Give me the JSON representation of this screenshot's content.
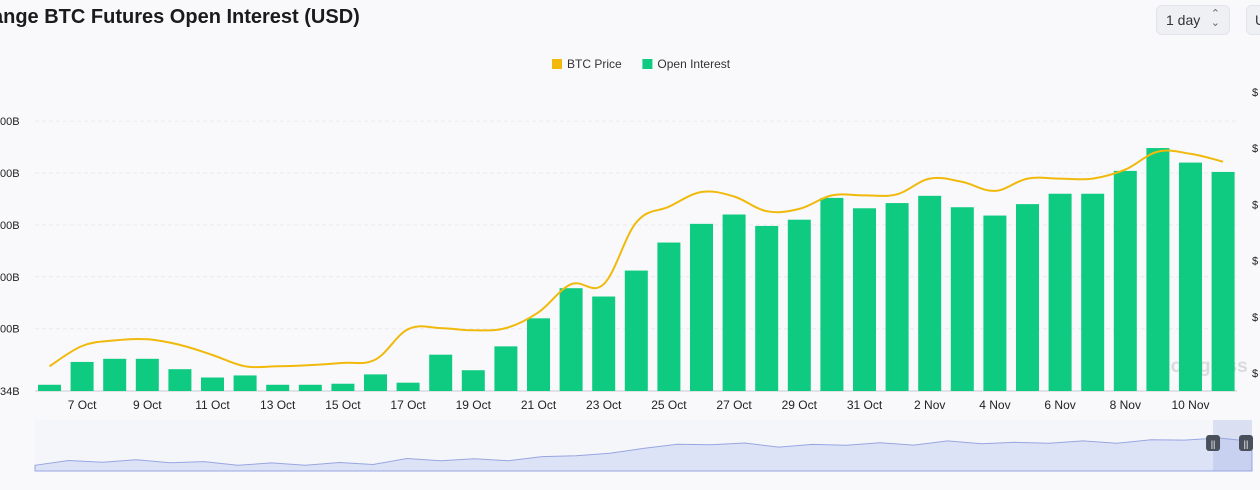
{
  "header": {
    "title": "ange BTC Futures Open Interest (USD)",
    "interval_label": "1 day",
    "unit_label": "U"
  },
  "chart_data": {
    "type": "bar",
    "title": "ange BTC Futures Open Interest (USD)",
    "legend": {
      "placement": "top-center",
      "items": [
        {
          "label": "BTC Price",
          "color": "#f0b90b"
        },
        {
          "label": "Open Interest",
          "color": "#0ecb81"
        }
      ]
    },
    "watermark": "coinglass",
    "grid": true,
    "y_left": {
      "tick_labels": [
        "34B",
        "00B",
        "00B",
        "00B",
        "00B",
        "00B"
      ],
      "tick_values": [
        34,
        40,
        45,
        50,
        55,
        60
      ],
      "range": [
        34,
        62.8
      ]
    },
    "y_right": {
      "tick_labels": [
        "$",
        "$",
        "$",
        "$",
        "$",
        "$"
      ],
      "tick_values": [
        54.6,
        59.6,
        64.6,
        69.6,
        74.6,
        79.6
      ],
      "range": [
        53,
        79.6
      ]
    },
    "x_tick_labels": [
      "7 Oct",
      "9 Oct",
      "11 Oct",
      "13 Oct",
      "15 Oct",
      "17 Oct",
      "19 Oct",
      "21 Oct",
      "23 Oct",
      "25 Oct",
      "27 Oct",
      "29 Oct",
      "31 Oct",
      "2 Nov",
      "4 Nov",
      "6 Nov",
      "8 Nov",
      "10 Nov"
    ],
    "categories": [
      "6 Oct",
      "7 Oct",
      "8 Oct",
      "9 Oct",
      "10 Oct",
      "11 Oct",
      "12 Oct",
      "13 Oct",
      "14 Oct",
      "15 Oct",
      "16 Oct",
      "17 Oct",
      "18 Oct",
      "19 Oct",
      "20 Oct",
      "21 Oct",
      "22 Oct",
      "23 Oct",
      "24 Oct",
      "25 Oct",
      "26 Oct",
      "27 Oct",
      "28 Oct",
      "29 Oct",
      "30 Oct",
      "31 Oct",
      "1 Nov",
      "2 Nov",
      "3 Nov",
      "4 Nov",
      "5 Nov",
      "6 Nov",
      "7 Nov",
      "8 Nov",
      "9 Nov",
      "10 Nov",
      "11 Nov"
    ],
    "series": [
      {
        "name": "Open Interest",
        "color": "#0ecb81",
        "values": [
          34.6,
          36.8,
          37.1,
          37.1,
          36.1,
          35.3,
          35.5,
          34.6,
          34.6,
          34.7,
          35.6,
          34.8,
          37.5,
          36.0,
          38.3,
          41.0,
          43.9,
          43.1,
          45.6,
          48.3,
          50.1,
          51.0,
          49.9,
          50.5,
          52.6,
          51.6,
          52.1,
          52.8,
          51.7,
          50.9,
          52.0,
          53.0,
          53.0,
          55.2,
          57.4,
          56.0,
          55.1
        ]
      },
      {
        "name": "BTC Price",
        "color": "#f0b90b",
        "values": [
          55.2,
          57.0,
          57.5,
          57.6,
          57.1,
          56.2,
          55.2,
          55.2,
          55.3,
          55.5,
          55.8,
          58.5,
          58.6,
          58.4,
          58.6,
          60.0,
          62.5,
          62.5,
          68.0,
          69.4,
          70.7,
          70.3,
          69.0,
          69.2,
          70.4,
          70.4,
          70.5,
          71.9,
          71.6,
          70.8,
          71.9,
          71.9,
          71.9,
          72.7,
          74.3,
          74.1,
          73.4
        ]
      }
    ]
  },
  "navigator": {
    "handle_left": "||",
    "handle_right": "||",
    "selected_fraction": 0.08
  }
}
